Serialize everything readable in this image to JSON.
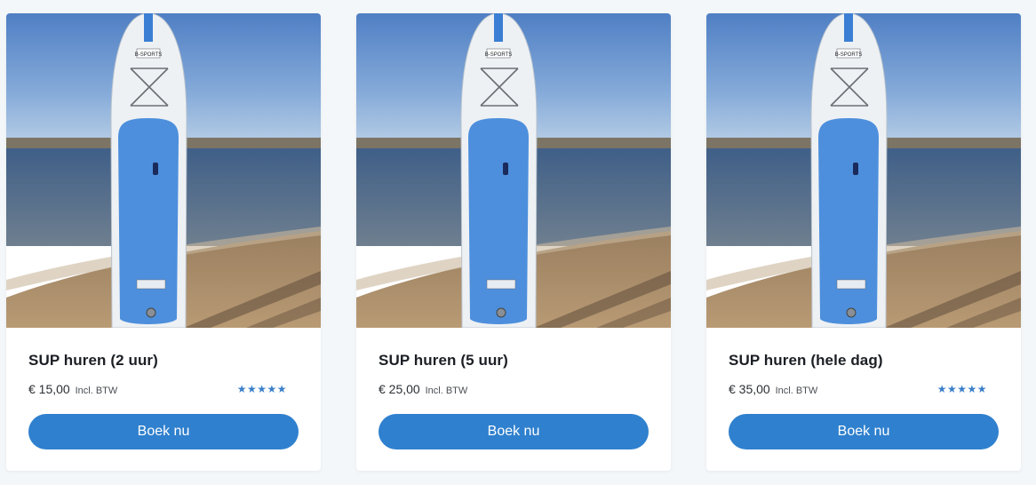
{
  "products": [
    {
      "title": "SUP huren (2 uur)",
      "price": "€ 15,00",
      "vat_note": "Incl. BTW",
      "rating_stars": "★★★★★",
      "rating_value": 5,
      "button_label": "Boek nu",
      "board_brand": "B-SPORTS"
    },
    {
      "title": "SUP huren (5 uur)",
      "price": "€ 25,00",
      "vat_note": "Incl. BTW",
      "rating_stars": "",
      "button_label": "Boek nu",
      "board_brand": "B-SPORTS"
    },
    {
      "title": "SUP huren (hele dag)",
      "price": "€ 35,00",
      "vat_note": "Incl. BTW",
      "rating_stars": "★★★★★",
      "rating_value": 5,
      "button_label": "Boek nu",
      "board_brand": "B-SPORTS"
    }
  ],
  "colors": {
    "button": "#2f80ce",
    "stars": "#3a7fc9",
    "board_deck": "#4d8fdc",
    "background": "#f4f7fa"
  }
}
